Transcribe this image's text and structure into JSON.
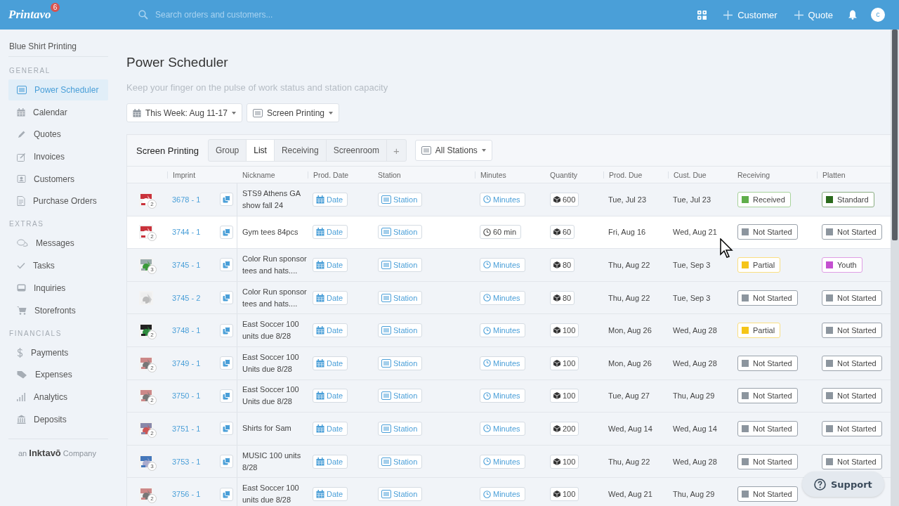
{
  "topbar": {
    "logo": "Printavo",
    "notification_count": "6",
    "search": {
      "placeholder": "Search orders and customers..."
    },
    "actions": [
      {
        "label": "Customer"
      },
      {
        "label": "Quote"
      }
    ],
    "avatar": "c"
  },
  "sidebar": {
    "company": "Blue Shirt Printing",
    "sections": [
      {
        "title": "GENERAL",
        "items": [
          {
            "label": "Power Scheduler",
            "selected": true
          },
          {
            "label": "Calendar",
            "selected": false
          },
          {
            "label": "Quotes",
            "selected": false
          },
          {
            "label": "Invoices",
            "selected": false
          },
          {
            "label": "Customers",
            "selected": false
          },
          {
            "label": "Purchase Orders",
            "selected": false
          }
        ]
      },
      {
        "title": "EXTRAS",
        "items": [
          {
            "label": "Messages",
            "selected": false
          },
          {
            "label": "Tasks",
            "selected": false
          },
          {
            "label": "Inquiries",
            "selected": false
          },
          {
            "label": "Storefronts",
            "selected": false
          }
        ]
      },
      {
        "title": "FINANCIALS",
        "items": [
          {
            "label": "Payments",
            "selected": false
          },
          {
            "label": "Expenses",
            "selected": false
          },
          {
            "label": "Analytics",
            "selected": false
          },
          {
            "label": "Deposits",
            "selected": false
          }
        ]
      }
    ],
    "footer": "an **Inktavō** Company"
  },
  "page": {
    "title": "Power Scheduler",
    "subtitle": "Keep your finger on the pulse of work status and station capacity",
    "filters": [
      {
        "label": "This Week: Aug 11-17"
      },
      {
        "label": "Screen Printing"
      }
    ]
  },
  "scheduler": {
    "title": "Screen Printing",
    "views": [
      {
        "label": "Group",
        "selected": false
      },
      {
        "label": "List",
        "selected": true
      },
      {
        "label": "Receiving",
        "selected": false
      },
      {
        "label": "Screenroom",
        "selected": false
      }
    ],
    "add_view": "+",
    "station_filter": "All Stations",
    "columns": [
      "Imprint",
      "Nickname",
      "Prod. Date",
      "Station",
      "Minutes",
      "Quantity",
      "Prod. Due",
      "Cust. Due",
      "Receiving",
      "Platten"
    ],
    "rows": [
      {
        "count": "2",
        "imprint": "3678 - 1",
        "nickname": "STS9 Athens GA show fall 24",
        "prod_date": "Date",
        "station": "Station",
        "minutes": "Minutes",
        "minutes_set": false,
        "quantity": "600",
        "prod_due": "Tue, Jul 23",
        "cust_due": "Tue, Jul 23",
        "receiving": {
          "label": "Received",
          "color": "#5fae4a"
        },
        "platten": {
          "label": "Standard",
          "color": "#2b6a1c"
        },
        "hovered": false
      },
      {
        "count": "2",
        "imprint": "3744 - 1",
        "nickname": "Gym tees 84pcs",
        "prod_date": "Date",
        "station": "Station",
        "minutes": "60 min",
        "minutes_set": true,
        "quantity": "60",
        "prod_due": "Fri, Aug 16",
        "cust_due": "Wed, Aug 21",
        "receiving": {
          "label": "Not Started",
          "color": "#8c959e"
        },
        "platten": {
          "label": "Not Started",
          "color": "#8c959e"
        },
        "hovered": true
      },
      {
        "count": "3",
        "imprint": "3745 - 1",
        "nickname": "Color Run sponsor tees and hats....",
        "prod_date": "Date",
        "station": "Station",
        "minutes": "Minutes",
        "minutes_set": false,
        "quantity": "80",
        "prod_due": "Thu, Aug 22",
        "cust_due": "Tue, Sep 3",
        "receiving": {
          "label": "Partial",
          "color": "#f5c518"
        },
        "platten": {
          "label": "Youth",
          "color": "#c44fd0"
        },
        "hovered": false
      },
      {
        "imprint": "3745 - 2",
        "nickname": "Color Run sponsor tees and hats....",
        "prod_date": "Date",
        "station": "Station",
        "minutes": "Minutes",
        "minutes_set": false,
        "quantity": "80",
        "prod_due": "Thu, Aug 22",
        "cust_due": "Tue, Sep 3",
        "receiving": {
          "label": "Not Started",
          "color": "#8c959e"
        },
        "platten": {
          "label": "Not Started",
          "color": "#8c959e"
        },
        "hovered": false
      },
      {
        "count": "2",
        "imprint": "3748 - 1",
        "nickname": "East Soccer 100 units due 8/28",
        "prod_date": "Date",
        "station": "Station",
        "minutes": "Minutes",
        "minutes_set": false,
        "quantity": "100",
        "prod_due": "Mon, Aug 26",
        "cust_due": "Wed, Aug 28",
        "receiving": {
          "label": "Partial",
          "color": "#f5c518"
        },
        "platten": {
          "label": "Not Started",
          "color": "#8c959e"
        },
        "hovered": false
      },
      {
        "count": "2",
        "imprint": "3749 - 1",
        "nickname": "East Soccer 100 Units due 8/28",
        "prod_date": "Date",
        "station": "Station",
        "minutes": "Minutes",
        "minutes_set": false,
        "quantity": "100",
        "prod_due": "Mon, Aug 26",
        "cust_due": "Wed, Aug 28",
        "receiving": {
          "label": "Not Started",
          "color": "#8c959e"
        },
        "platten": {
          "label": "Not Started",
          "color": "#8c959e"
        },
        "hovered": false
      },
      {
        "count": "2",
        "imprint": "3750 - 1",
        "nickname": "East Soccer 100 Units due 8/28",
        "prod_date": "Date",
        "station": "Station",
        "minutes": "Minutes",
        "minutes_set": false,
        "quantity": "100",
        "prod_due": "Tue, Aug 27",
        "cust_due": "Thu, Aug 29",
        "receiving": {
          "label": "Not Started",
          "color": "#8c959e"
        },
        "platten": {
          "label": "Not Started",
          "color": "#8c959e"
        },
        "hovered": false
      },
      {
        "count": "2",
        "imprint": "3751 - 1",
        "nickname": "Shirts for Sam",
        "prod_date": "Date",
        "station": "Station",
        "minutes": "Minutes",
        "minutes_set": false,
        "quantity": "200",
        "prod_due": "Wed, Aug 14",
        "cust_due": "Wed, Aug 14",
        "receiving": {
          "label": "Not Started",
          "color": "#8c959e"
        },
        "platten": {
          "label": "Not Started",
          "color": "#8c959e"
        },
        "hovered": false
      },
      {
        "count": "3",
        "imprint": "3753 - 1",
        "nickname": "MUSIC 100 units 8/28",
        "prod_date": "Date",
        "station": "Station",
        "minutes": "Minutes",
        "minutes_set": false,
        "quantity": "100",
        "prod_due": "Thu, Aug 22",
        "cust_due": "Wed, Aug 28",
        "receiving": {
          "label": "Not Started",
          "color": "#8c959e"
        },
        "platten": {
          "label": "Not Started",
          "color": "#8c959e"
        },
        "hovered": false
      },
      {
        "count": "2",
        "imprint": "3756 - 1",
        "nickname": "East Soccer 100 units due 8/28",
        "prod_date": "Date",
        "station": "Station",
        "minutes": "Minutes",
        "minutes_set": false,
        "quantity": "100",
        "prod_due": "Wed, Aug 21",
        "cust_due": "Thu, Aug 29",
        "receiving": {
          "label": "Not Started",
          "color": "#8c959e"
        },
        "hovered": false
      }
    ]
  },
  "support": {
    "label": "Support"
  }
}
